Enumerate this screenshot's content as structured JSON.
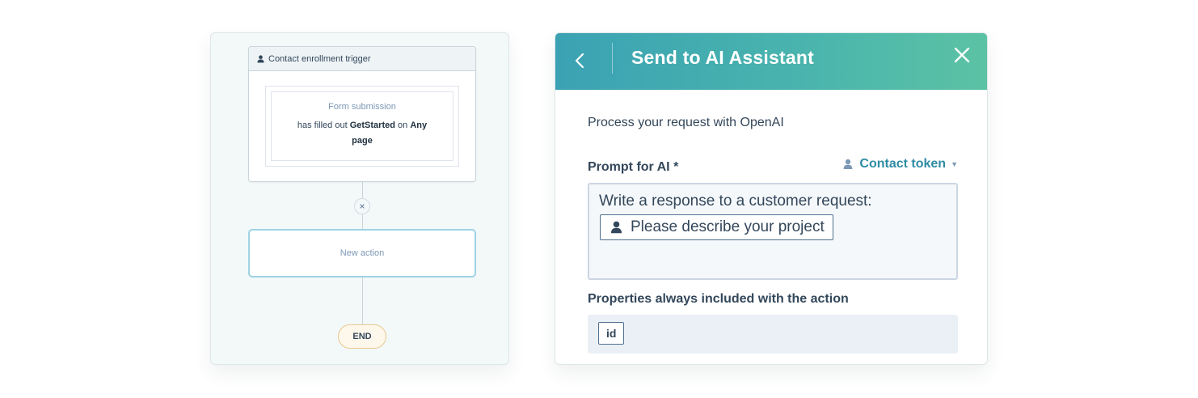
{
  "workflow": {
    "trigger_title": "Contact enrollment trigger",
    "filter_title": "Form submission",
    "filter_line1_prefix": "has filled out",
    "filter_form_name": "GetStarted",
    "filter_line1_mid": "on",
    "filter_line1_suffix": "Any",
    "filter_line2": "page",
    "remove_label": "×",
    "new_action_label": "New action",
    "end_label": "END"
  },
  "ai_panel": {
    "back_label": "‹",
    "title": "Send to AI Assistant",
    "close_label": "✕",
    "intro": "Process your request with OpenAI",
    "prompt_label": "Prompt for AI *",
    "token_button_label": "Contact token",
    "prompt_text": "Write a response to a customer request:",
    "prompt_token": "Please describe your project",
    "properties_label": "Properties always included with the action",
    "properties": [
      "id"
    ]
  },
  "colors": {
    "header_gradient_start": "#3aa2b3",
    "header_gradient_end": "#5cc2a4",
    "link": "#2f8ca3",
    "text": "#33475b"
  },
  "icons": {
    "contact": "person-icon",
    "remove": "close-icon",
    "back": "chevron-left-icon",
    "close": "close-icon",
    "caret": "caret-down-icon"
  }
}
